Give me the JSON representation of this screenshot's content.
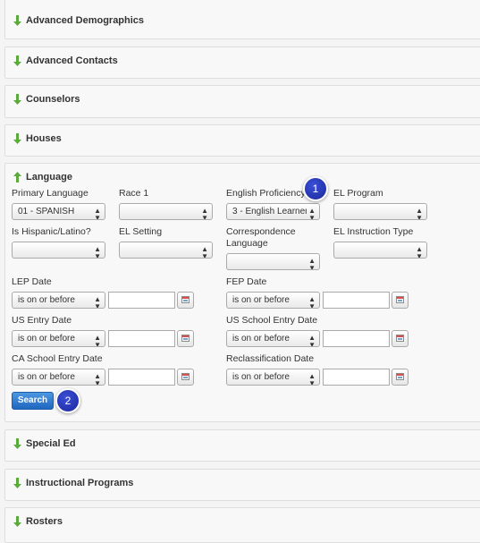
{
  "sections": {
    "advanced_demographics": "Advanced Demographics",
    "advanced_contacts": "Advanced Contacts",
    "counselors": "Counselors",
    "houses": "Houses",
    "language": "Language",
    "special_ed": "Special Ed",
    "instructional_programs": "Instructional Programs",
    "rosters": "Rosters"
  },
  "language": {
    "primary_language": {
      "label": "Primary Language",
      "value": "01 - SPANISH"
    },
    "race1": {
      "label": "Race 1",
      "value": ""
    },
    "english_proficiency": {
      "label": "English Proficiency",
      "value": "3 - English Learner"
    },
    "el_program": {
      "label": "EL Program",
      "value": ""
    },
    "is_hispanic": {
      "label": "Is Hispanic/Latino?",
      "value": ""
    },
    "el_setting": {
      "label": "EL Setting",
      "value": ""
    },
    "correspondence_language": {
      "label": "Correspondence Language",
      "value": ""
    },
    "el_instruction_type": {
      "label": "EL Instruction Type",
      "value": ""
    },
    "lep_date": {
      "label": "LEP Date",
      "operator": "is on or before",
      "value": ""
    },
    "fep_date": {
      "label": "FEP Date",
      "operator": "is on or before",
      "value": ""
    },
    "us_entry_date": {
      "label": "US Entry Date",
      "operator": "is on or before",
      "value": ""
    },
    "us_school_entry_date": {
      "label": "US School Entry Date",
      "operator": "is on or before",
      "value": ""
    },
    "ca_school_entry_date": {
      "label": "CA School Entry Date",
      "operator": "is on or before",
      "value": ""
    },
    "reclassification_date": {
      "label": "Reclassification Date",
      "operator": "is on or before",
      "value": ""
    },
    "search_label": "Search"
  },
  "annotations": {
    "badge1": "1",
    "badge2": "2"
  },
  "colors": {
    "arrow_green": "#5aab3c",
    "button_blue": "#1f66c0",
    "badge_blue": "#1a2899"
  },
  "icons": {
    "collapsed": "down-arrow-icon",
    "expanded": "up-arrow-icon",
    "calendar": "calendar-icon"
  }
}
